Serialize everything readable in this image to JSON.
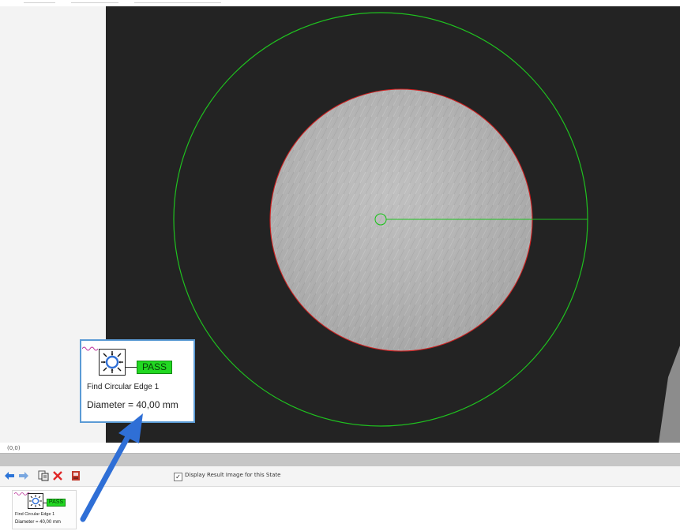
{
  "coordinate_readout": "(0,0)",
  "toolbar": {
    "back_icon": "arrow-left-icon",
    "forward_icon": "arrow-right-icon",
    "copy_icon": "copy-icon",
    "delete_icon": "delete-x-icon",
    "export_icon": "export-icon",
    "display_result_checked": true,
    "display_result_label": "Display Result Image for this State"
  },
  "step_card": {
    "icon": "circular-edge-icon",
    "status": "PASS",
    "step_name": "Find Circular Edge 1",
    "result": "Diameter = 40,00 mm"
  },
  "colors": {
    "pass_green": "#22d822",
    "roi_green": "#1fc21f",
    "edge_red": "#d02020",
    "arrow_blue": "#2f6fd6",
    "card_border": "#5b9bd5",
    "image_background": "#232323"
  }
}
